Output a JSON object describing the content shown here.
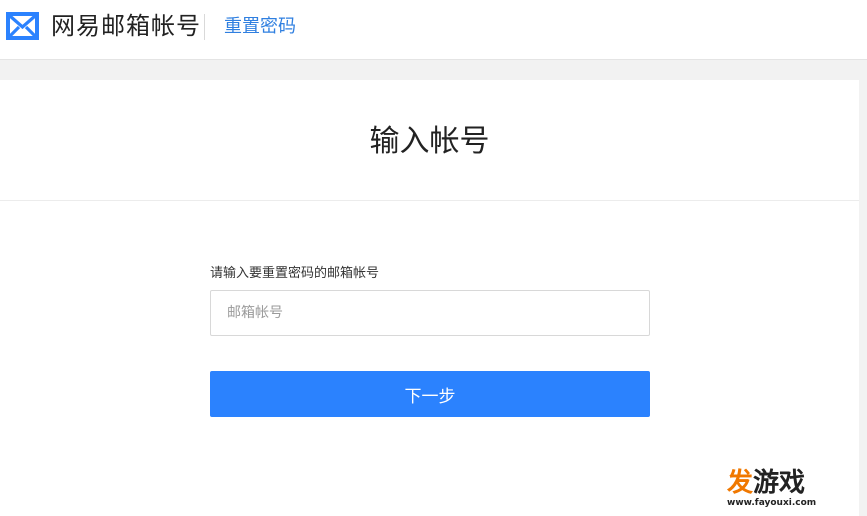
{
  "header": {
    "brand": "网易邮箱帐号",
    "breadcrumb": "重置密码",
    "logo_icon": "mail-envelope-icon",
    "brand_color": "#2b82fe"
  },
  "main": {
    "title": "输入帐号",
    "field_label": "请输入要重置密码的邮箱帐号",
    "email_placeholder": "邮箱帐号",
    "email_value": "",
    "next_button": "下一步",
    "button_color": "#2b82fe"
  },
  "watermark": {
    "part1": "发",
    "part2": "游戏",
    "url": "www.fayouxi.com"
  }
}
